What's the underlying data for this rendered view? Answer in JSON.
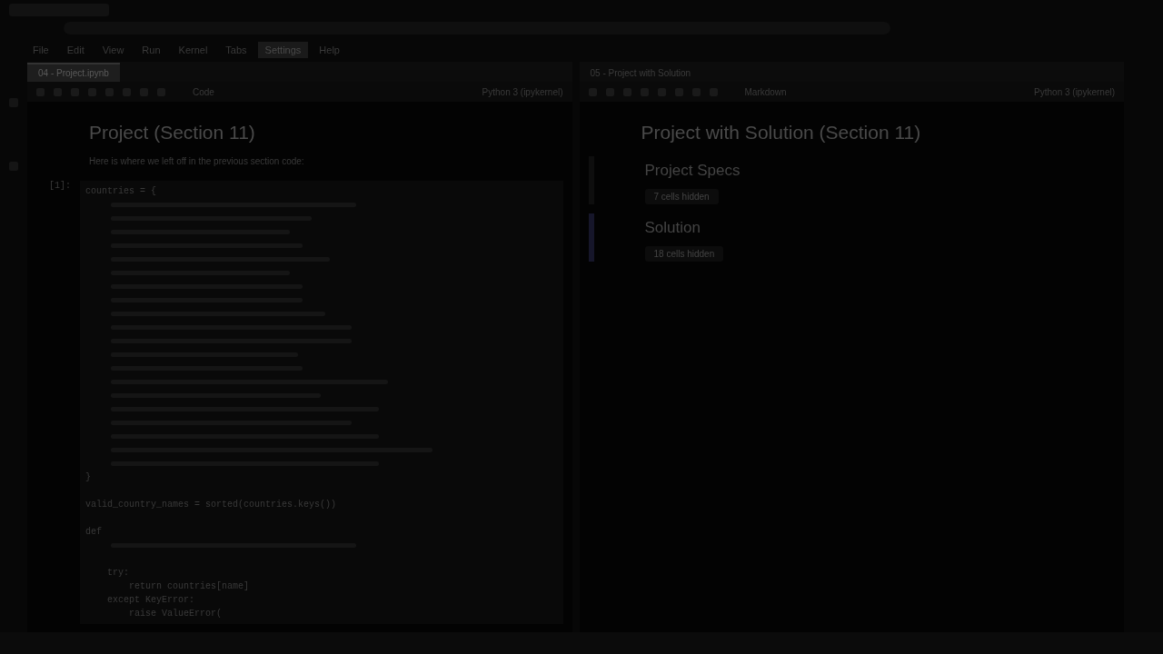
{
  "menu": [
    {
      "label": "File",
      "selected": false
    },
    {
      "label": "Edit",
      "selected": false
    },
    {
      "label": "View",
      "selected": false
    },
    {
      "label": "Run",
      "selected": false
    },
    {
      "label": "Kernel",
      "selected": false
    },
    {
      "label": "Tabs",
      "selected": false
    },
    {
      "label": "Settings",
      "selected": true
    },
    {
      "label": "Help",
      "selected": false
    }
  ],
  "panels": [
    {
      "tab": "04 - Project.ipynb",
      "tab_selected": true,
      "cell_type": "Code",
      "kernel": "Python 3 (ipykernel)",
      "title": "Project (Section 11)",
      "intro": "Here is where we left off in the previous section code:",
      "prompt": "[1]:",
      "code": [
        {
          "kind": "text",
          "text": "countries = {"
        },
        {
          "kind": "blur"
        },
        {
          "kind": "blur"
        },
        {
          "kind": "blur"
        },
        {
          "kind": "blur"
        },
        {
          "kind": "blur"
        },
        {
          "kind": "blur"
        },
        {
          "kind": "blur"
        },
        {
          "kind": "blur"
        },
        {
          "kind": "blur"
        },
        {
          "kind": "blur"
        },
        {
          "kind": "blur"
        },
        {
          "kind": "blur"
        },
        {
          "kind": "blur"
        },
        {
          "kind": "blur"
        },
        {
          "kind": "blur"
        },
        {
          "kind": "blur"
        },
        {
          "kind": "blur"
        },
        {
          "kind": "blur"
        },
        {
          "kind": "blur"
        },
        {
          "kind": "blur"
        },
        {
          "kind": "text",
          "text": "}"
        },
        {
          "kind": "gap"
        },
        {
          "kind": "text",
          "text": "valid_country_names = sorted(countries.keys())"
        },
        {
          "kind": "gap"
        },
        {
          "kind": "text",
          "text": "def"
        },
        {
          "kind": "blur"
        },
        {
          "kind": "gap"
        },
        {
          "kind": "text",
          "text": "    try:"
        },
        {
          "kind": "text",
          "text": "        return countries[name]"
        },
        {
          "kind": "text",
          "text": "    except KeyError:"
        },
        {
          "kind": "text",
          "text": "        raise ValueError("
        }
      ]
    },
    {
      "tab": "05 - Project with Solution",
      "tab_selected": false,
      "cell_type": "Markdown",
      "kernel": "Python 3 (ipykernel)",
      "title": "Project with Solution (Section 11)",
      "sections": [
        {
          "heading": "Project Specs",
          "hidden": "7 cells hidden",
          "selected": false
        },
        {
          "heading": "Solution",
          "hidden": "18 cells hidden",
          "selected": true
        }
      ]
    }
  ]
}
